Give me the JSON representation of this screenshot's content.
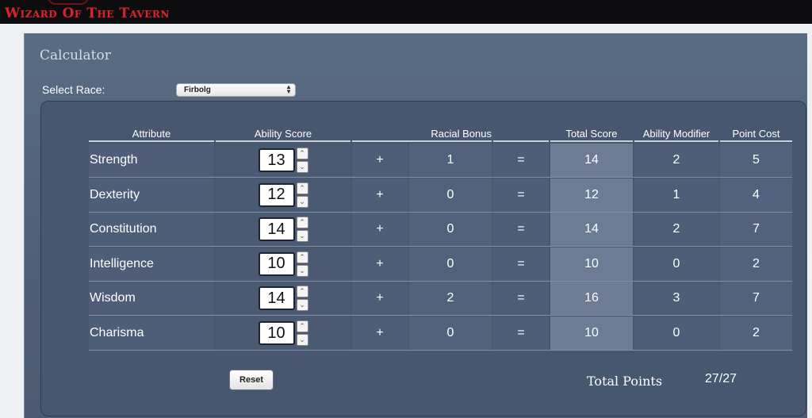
{
  "site": {
    "logo_text": "Wizard Of The Tavern"
  },
  "panel": {
    "title": "Calculator"
  },
  "race": {
    "label": "Select Race:",
    "selected": "Firbolg"
  },
  "table": {
    "headers": {
      "attribute": "Attribute",
      "ability_score": "Ability Score",
      "racial_bonus": "Racial Bonus",
      "total_score": "Total Score",
      "ability_modifier": "Ability Modifier",
      "point_cost": "Point Cost"
    },
    "plus_symbol": "+",
    "equals_symbol": "=",
    "rows": [
      {
        "attribute": "Strength",
        "score": "13",
        "racial": "1",
        "total": "14",
        "modifier": "2",
        "cost": "5"
      },
      {
        "attribute": "Dexterity",
        "score": "12",
        "racial": "0",
        "total": "12",
        "modifier": "1",
        "cost": "4"
      },
      {
        "attribute": "Constitution",
        "score": "14",
        "racial": "0",
        "total": "14",
        "modifier": "2",
        "cost": "7"
      },
      {
        "attribute": "Intelligence",
        "score": "10",
        "racial": "0",
        "total": "10",
        "modifier": "0",
        "cost": "2"
      },
      {
        "attribute": "Wisdom",
        "score": "14",
        "racial": "2",
        "total": "16",
        "modifier": "3",
        "cost": "7"
      },
      {
        "attribute": "Charisma",
        "score": "10",
        "racial": "0",
        "total": "10",
        "modifier": "0",
        "cost": "2"
      }
    ]
  },
  "footer": {
    "reset_label": "Reset",
    "total_label": "Total Points",
    "total_value": "27/27"
  },
  "icons": {
    "spin_up": "chevron-up-icon",
    "spin_down": "chevron-down-icon",
    "select_arrows": "select-arrows-icon"
  },
  "colors": {
    "logo": "#d2262b",
    "panel": "#4f5f77",
    "total_column": "#6b7c94"
  }
}
